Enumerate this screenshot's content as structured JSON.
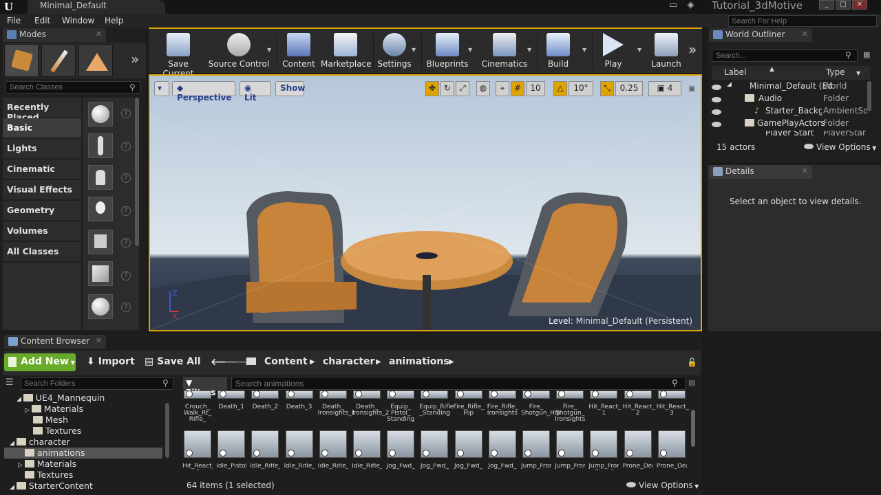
{
  "titlebar": {
    "document_tab": "Minimal_Default",
    "app_title": "Tutorial_3dMotive",
    "help_search_placeholder": "Search For Help"
  },
  "menu": {
    "items": [
      "File",
      "Edit",
      "Window",
      "Help"
    ]
  },
  "modes": {
    "tab_label": "Modes",
    "search_placeholder": "Search Classes",
    "categories": [
      "Recently Placed",
      "Basic",
      "Lights",
      "Cinematic",
      "Visual Effects",
      "Geometry",
      "Volumes",
      "All Classes"
    ],
    "active_category": "Basic",
    "help_glyph": "?"
  },
  "toolbar": {
    "buttons": [
      {
        "label": "Save Current",
        "icon": "save-icon"
      },
      {
        "label": "Source Control",
        "icon": "source-control-icon"
      },
      {
        "label": "Content",
        "icon": "content-icon"
      },
      {
        "label": "Marketplace",
        "icon": "marketplace-icon"
      },
      {
        "label": "Settings",
        "icon": "settings-icon"
      },
      {
        "label": "Blueprints",
        "icon": "blueprints-icon"
      },
      {
        "label": "Cinematics",
        "icon": "cinematics-icon"
      },
      {
        "label": "Build",
        "icon": "build-icon"
      },
      {
        "label": "Play",
        "icon": "play-icon"
      },
      {
        "label": "Launch",
        "icon": "launch-icon"
      }
    ],
    "overflow_glyph": "»"
  },
  "viewport": {
    "perspective_label": "Perspective",
    "lit_label": "Lit",
    "show_label": "Show",
    "grid_snap": "10",
    "rotation_snap": "10°",
    "scale_snap": "0.25",
    "camera_speed": "4",
    "level_prefix": "Level:",
    "level_name": "Minimal_Default (Persistent)",
    "axis_z": "Z",
    "axis_x": "X"
  },
  "outliner": {
    "tab_label": "World Outliner",
    "search_placeholder": "Search...",
    "col_label": "Label",
    "col_type": "Type",
    "rows": [
      {
        "label": "Minimal_Default (Ed",
        "type": "World"
      },
      {
        "label": "Audio",
        "type": "Folder"
      },
      {
        "label": "Starter_Backgrc",
        "type": "AmbientSo"
      },
      {
        "label": "GamePlayActors",
        "type": "Folder"
      },
      {
        "label": "Player Start",
        "type": "PlayerStart"
      }
    ],
    "actors_count": "15 actors",
    "view_options": "View Options"
  },
  "details": {
    "tab_label": "Details",
    "empty_message": "Select an object to view details."
  },
  "content_browser": {
    "tab_label": "Content Browser",
    "add_new": "Add New",
    "import": "Import",
    "save_all": "Save All",
    "breadcrumb": [
      "Content",
      "character",
      "animations"
    ],
    "folder_search_placeholder": "Search Folders",
    "filters_label": "Filters",
    "asset_search_placeholder": "Search animations",
    "tree": [
      {
        "label": "UE4_Mannequin",
        "depth": 1,
        "expanded": true
      },
      {
        "label": "Materials",
        "depth": 2,
        "expanded": false
      },
      {
        "label": "Mesh",
        "depth": 2
      },
      {
        "label": "Textures",
        "depth": 2
      },
      {
        "label": "character",
        "depth": 0,
        "expanded": true
      },
      {
        "label": "animations",
        "depth": 1,
        "selected": true
      },
      {
        "label": "Materials",
        "depth": 1,
        "expanded": false
      },
      {
        "label": "Textures",
        "depth": 1
      },
      {
        "label": "StarterContent",
        "depth": 0,
        "expanded": true
      }
    ],
    "assets_row1": [
      "Crouch_ Walk_Rt_ Rifle_",
      "Death_1",
      "Death_2",
      "Death_3",
      "Death_ Ironsights_1",
      "Death_ Ironsights_2",
      "Equip_ Pistol_ Standing",
      "Equip_Rifle _Standing",
      "Fire_Rifle_ Hip",
      "Fire_Rifle_ Ironsights",
      "Fire_ Shotgun_Hip",
      "Fire_ Shotgun_ Ironsights",
      "Hit_React_ 1",
      "Hit_React_ 2",
      "Hit_React_ 3"
    ],
    "assets_row2": [
      "Hit_React_ 4",
      "Idle_Pistol",
      "Idle_Rifle_",
      "Idle_Rifle_",
      "Idle_Rifle_",
      "Idle_Rifle_",
      "Jog_Fwd_",
      "Jog_Fwd_",
      "Jog_Fwd_",
      "Jog_Fwd_",
      "Jump_From",
      "Jump_From",
      "Jump_From Stand",
      "Prone_Death",
      "Prone_Death"
    ],
    "items_count": "64 items (1 selected)",
    "view_options": "View Options"
  }
}
